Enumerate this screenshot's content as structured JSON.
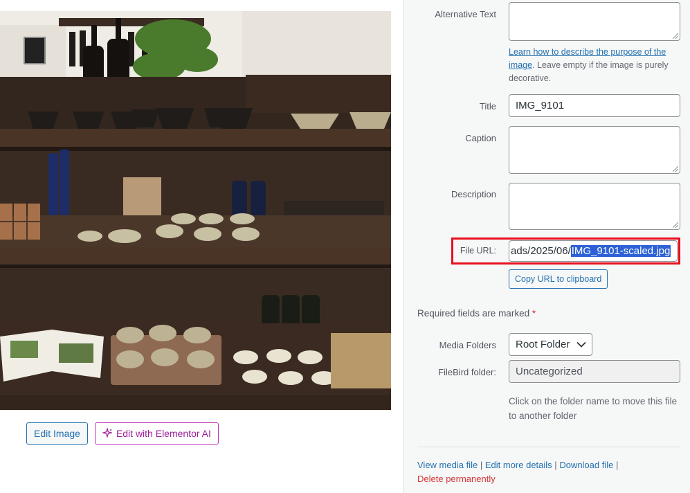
{
  "image_actions": {
    "edit_image": "Edit Image",
    "edit_ai": "Edit with Elementor AI"
  },
  "details": {
    "alt_text": {
      "label": "Alternative Text",
      "value": ""
    },
    "alt_help": {
      "link": "Learn how to describe the purpose of the image",
      "rest": ". Leave empty if the image is purely decorative."
    },
    "title": {
      "label": "Title",
      "value": "IMG_9101"
    },
    "caption": {
      "label": "Caption",
      "value": ""
    },
    "description": {
      "label": "Description",
      "value": ""
    },
    "file_url": {
      "label": "File URL:",
      "visible_prefix": "ads/2025/06/",
      "selected": "IMG_9101-scaled.jpg"
    },
    "copy_button": "Copy URL to clipboard",
    "required_note": "Required fields are marked",
    "required_star": "*",
    "media_folders": {
      "label": "Media Folders",
      "value": "Root Folder"
    },
    "filebird_folder": {
      "label": "FileBird folder:",
      "value": "Uncategorized"
    },
    "folder_note": "Click on the folder name to move this file to another folder"
  },
  "footer_links": {
    "view": "View media file",
    "edit_more": "Edit more details",
    "download": "Download file",
    "delete": "Delete permanently",
    "separator": "|"
  },
  "colors": {
    "accent": "#2271b1",
    "danger": "#d63638",
    "highlight": "#e8101d",
    "selection": "#2c62d6",
    "elementor": "#c036b8"
  }
}
